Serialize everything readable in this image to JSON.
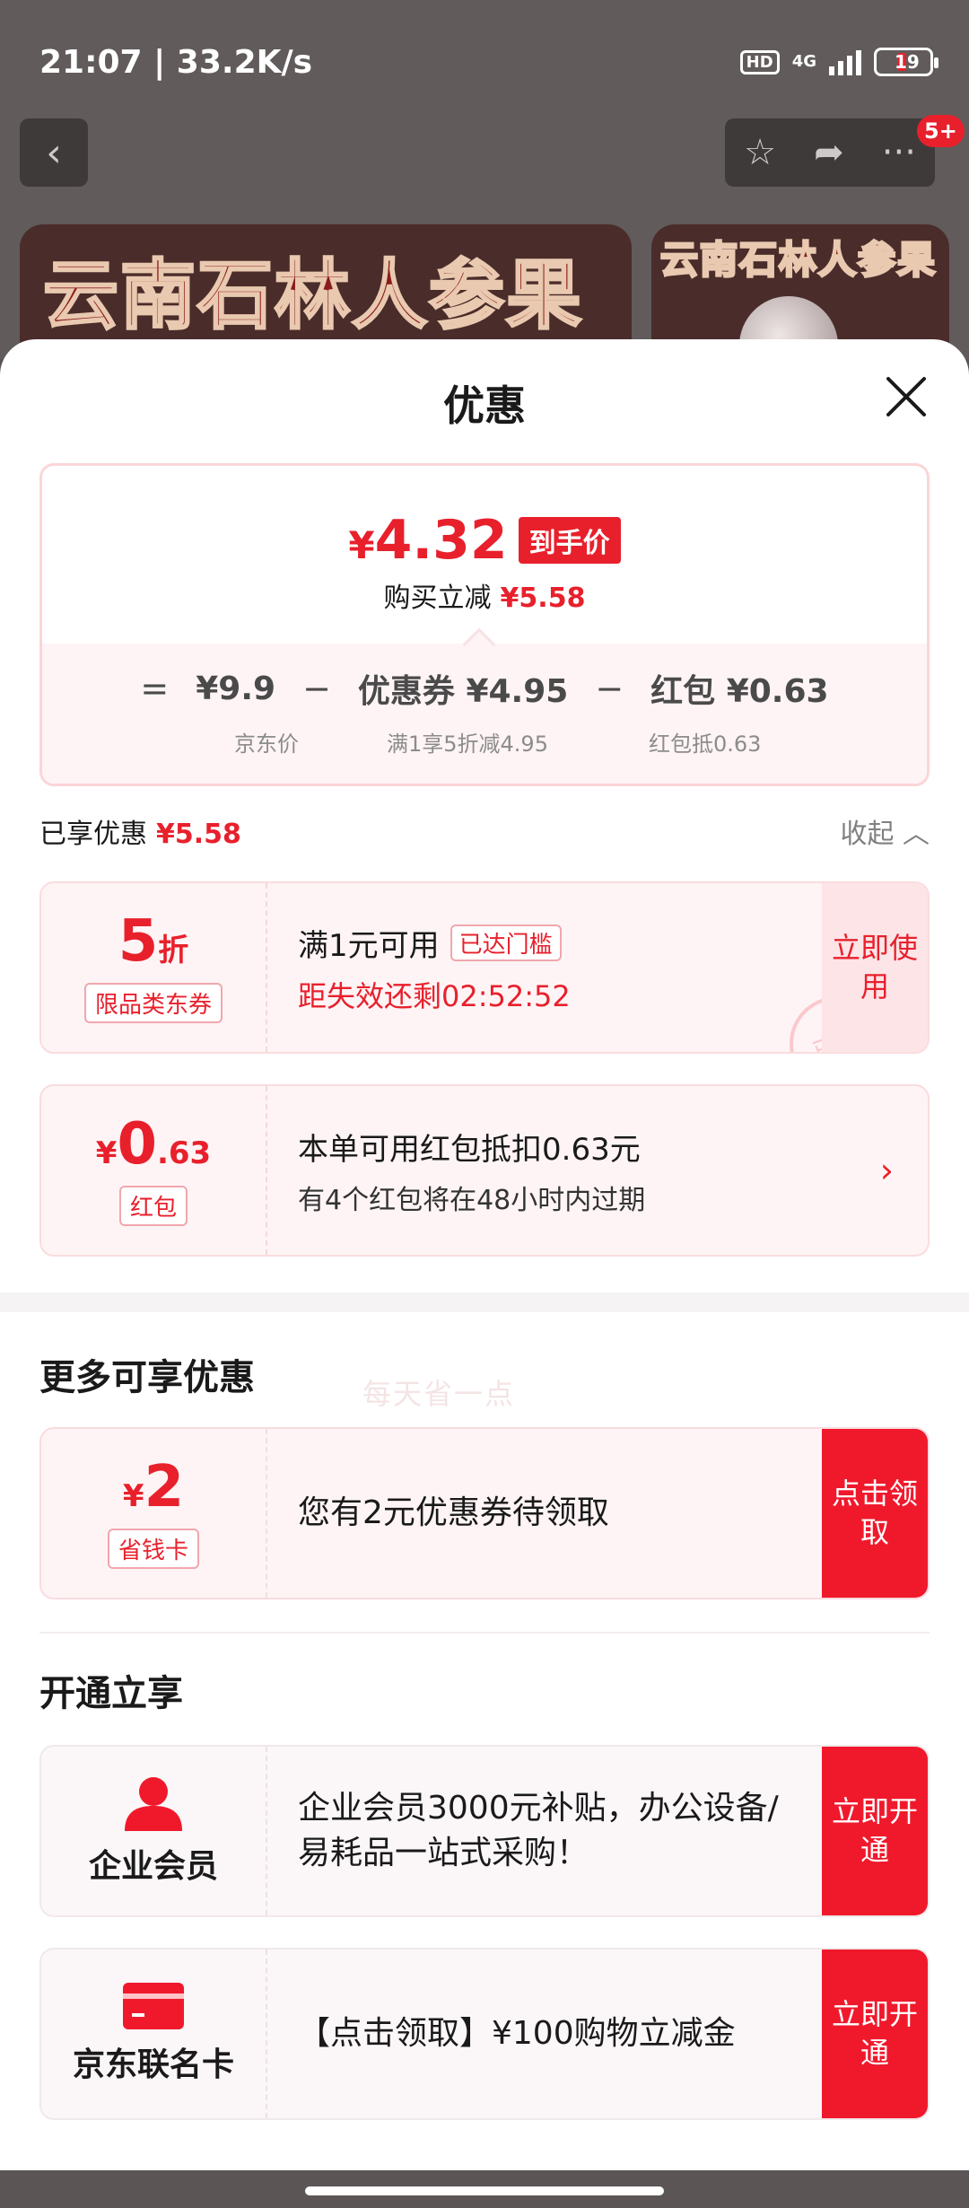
{
  "status_bar": {
    "time_speed": "21:07 | 33.2K/s",
    "hd": "HD",
    "network": "4G",
    "battery": "19"
  },
  "header": {
    "back_icon": "chevron-left-icon",
    "star_icon": "star-icon",
    "share_icon": "share-icon",
    "more_icon": "more-dots-icon",
    "badge": "5+"
  },
  "banner": {
    "text_main": "云南石林人参果",
    "text_side": "云南石林人参果"
  },
  "sheet": {
    "title": "优惠",
    "close_icon": "close-icon"
  },
  "summary": {
    "currency": "¥",
    "final_price": "4.32",
    "final_tag": "到手价",
    "save_label": "购买立减",
    "save_value": "¥5.58",
    "formula": {
      "eq": "=",
      "jd_price": "¥9.9",
      "minus1": "−",
      "coupon": "优惠券 ¥4.95",
      "minus2": "−",
      "redpacket": "红包 ¥0.63",
      "jd_price_label": "京东价",
      "coupon_label": "满1享5折减4.95",
      "redpacket_label": "红包抵0.63"
    }
  },
  "enjoyed": {
    "label": "已享优惠",
    "value": "¥5.58",
    "collapse": "收起"
  },
  "coupon_discount": {
    "value": "5",
    "unit": "折",
    "tag": "限品类东券",
    "condition": "满1元可用",
    "reached": "已达门槛",
    "countdown": "距失效还剩02:52:52",
    "use_label": "立即使用",
    "stamp": "已领",
    "watermark": "每天省一点"
  },
  "coupon_redpacket": {
    "cur": "¥",
    "value_int": "0",
    "value_dec": ".63",
    "tag": "红包",
    "line1": "本单可用红包抵扣0.63元",
    "line2": "有4个红包将在48小时内过期"
  },
  "more": {
    "title": "更多可享优惠",
    "card": {
      "cur": "¥",
      "value": "2",
      "tag": "省钱卡",
      "text": "您有2元优惠券待领取",
      "btn": "点击领取"
    }
  },
  "open": {
    "title": "开通立享",
    "enterprise": {
      "icon": "person-icon",
      "label": "企业会员",
      "text": "企业会员3000元补贴，办公设备/易耗品一站式采购！",
      "btn": "立即开通"
    },
    "cobrand": {
      "icon": "credit-card-icon",
      "label": "京东联名卡",
      "text": "【点击领取】¥100购物立减金",
      "btn": "立即开通"
    }
  }
}
